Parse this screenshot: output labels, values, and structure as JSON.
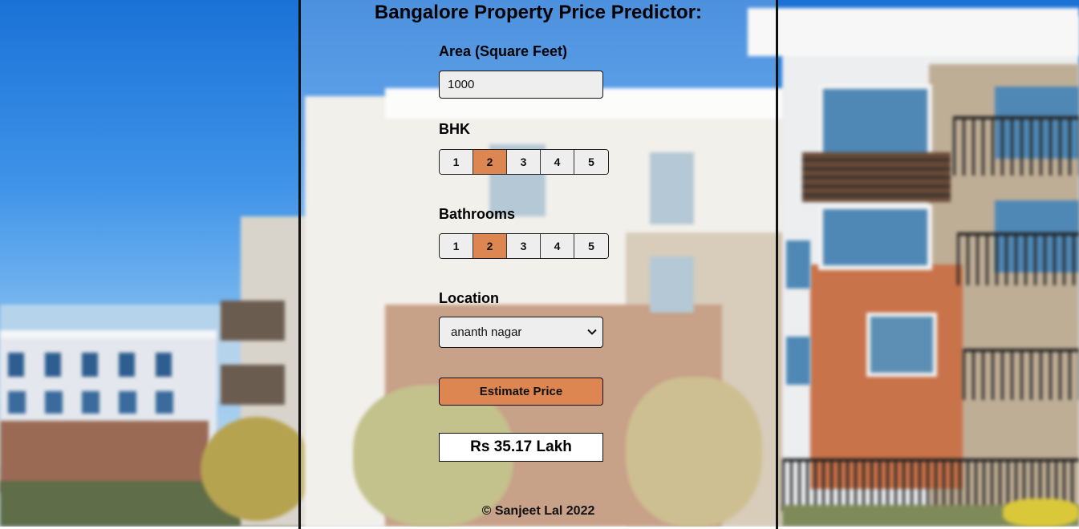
{
  "page": {
    "title": "Bangalore Property Price Predictor:",
    "footer": "© Sanjeet Lal 2022"
  },
  "area": {
    "label": "Area (Square Feet)",
    "value": "1000"
  },
  "bhk": {
    "label": "BHK",
    "options": [
      "1",
      "2",
      "3",
      "4",
      "5"
    ],
    "selected": "2"
  },
  "bathrooms": {
    "label": "Bathrooms",
    "options": [
      "1",
      "2",
      "3",
      "4",
      "5"
    ],
    "selected": "2"
  },
  "location": {
    "label": "Location",
    "selected": "ananth nagar"
  },
  "estimate": {
    "button_label": "Estimate Price"
  },
  "result": {
    "text": "Rs 35.17 Lakh"
  },
  "colors": {
    "accent": "#dd8652",
    "input_bg": "#eeeeee",
    "panel_border": "#111111"
  }
}
